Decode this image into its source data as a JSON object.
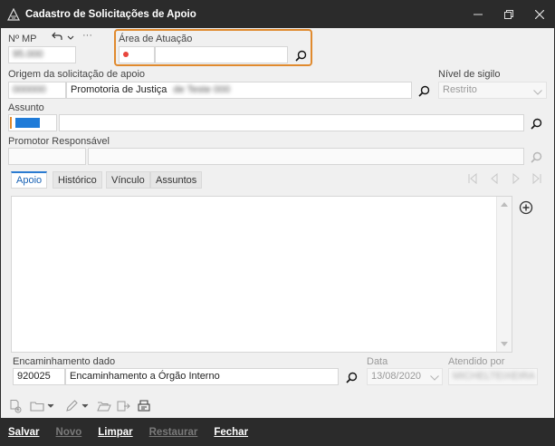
{
  "window": {
    "title": "Cadastro de Solicitações de Apoio",
    "minimize": "—",
    "restore": "❐",
    "close": "✕"
  },
  "header": {
    "nr_mp_label": "Nº MP",
    "nr_mp_value": "95.000",
    "undo_icon": "undo-arrow",
    "more": "···",
    "area_label": "Área de Atuação",
    "area_code": "",
    "area_desc": ""
  },
  "origem": {
    "label": "Origem da solicitação de apoio",
    "code": "000000",
    "desc": "Promotoria de Justiça",
    "desc_blurred": "de Teste 000"
  },
  "sigilo": {
    "label": "Nível de sigilo",
    "value": "Restrito"
  },
  "assunto": {
    "label": "Assunto",
    "code": "",
    "desc": ""
  },
  "promotor": {
    "label": "Promotor Responsável",
    "code": "",
    "desc": ""
  },
  "tabs": [
    {
      "label": "Apoio"
    },
    {
      "label": "Histórico"
    },
    {
      "label": "Vínculo"
    },
    {
      "label": "Assuntos"
    }
  ],
  "encaminhamento": {
    "label": "Encaminhamento dado",
    "code": "920025",
    "desc": "Encaminhamento a Órgão Interno"
  },
  "data": {
    "label": "Data",
    "value": "13/08/2020"
  },
  "atendido": {
    "label": "Atendido por",
    "value": "MICHELTEIXEIRA"
  },
  "footer": {
    "save": "Salvar",
    "new": "Novo",
    "clear": "Limpar",
    "restore": "Restaurar",
    "close": "Fechar"
  },
  "colors": {
    "titlebar": "#2b2b2b",
    "highlight": "#e08a2e",
    "active_tab": "#2a7bd1",
    "required_dot": "#e8453c",
    "assunto_chip": "#1f7bd8"
  }
}
